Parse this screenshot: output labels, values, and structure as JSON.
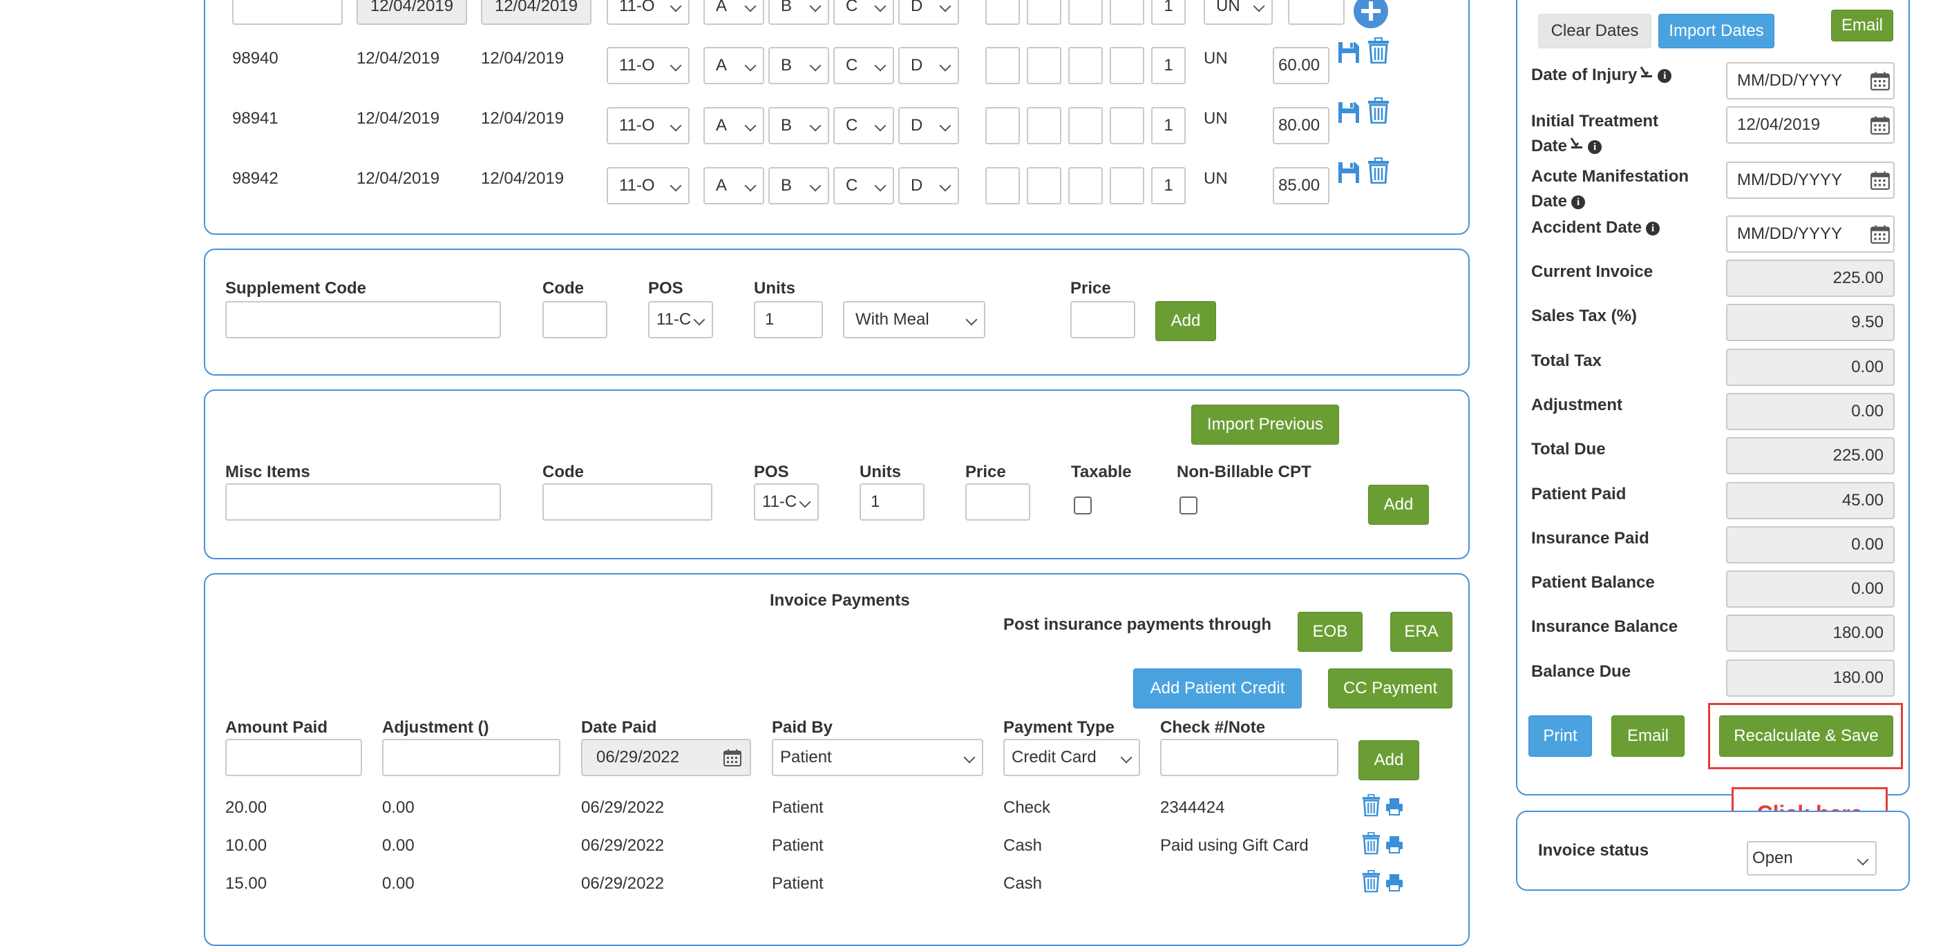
{
  "service_lines": {
    "top_row": {
      "date_from": "12/04/2019",
      "date_to": "12/04/2019",
      "pos": "11-O",
      "d1": "A",
      "d2": "B",
      "d3": "C",
      "d4": "D",
      "units": "1",
      "unit_type": "UN"
    },
    "rows": [
      {
        "code": "98940",
        "date_from": "12/04/2019",
        "date_to": "12/04/2019",
        "pos": "11-O",
        "d1": "A",
        "d2": "B",
        "d3": "C",
        "d4": "D",
        "units": "1",
        "unit_type": "UN",
        "price": "60.00"
      },
      {
        "code": "98941",
        "date_from": "12/04/2019",
        "date_to": "12/04/2019",
        "pos": "11-O",
        "d1": "A",
        "d2": "B",
        "d3": "C",
        "d4": "D",
        "units": "1",
        "unit_type": "UN",
        "price": "80.00"
      },
      {
        "code": "98942",
        "date_from": "12/04/2019",
        "date_to": "12/04/2019",
        "pos": "11-O",
        "d1": "A",
        "d2": "B",
        "d3": "C",
        "d4": "D",
        "units": "1",
        "unit_type": "UN",
        "price": "85.00"
      }
    ]
  },
  "supplement": {
    "code_label": "Supplement Code",
    "code2_label": "Code",
    "pos_label": "POS",
    "units_label": "Units",
    "price_label": "Price",
    "pos_value": "11-C",
    "units_value": "1",
    "meal_value": "With Meal",
    "add_label": "Add"
  },
  "misc": {
    "items_label": "Misc Items",
    "code_label": "Code",
    "pos_label": "POS",
    "units_label": "Units",
    "price_label": "Price",
    "taxable_label": "Taxable",
    "nonbillable_label": "Non-Billable CPT",
    "pos_value": "11-C",
    "units_value": "1",
    "import_previous_label": "Import Previous",
    "add_label": "Add"
  },
  "payments": {
    "title": "Invoice Payments",
    "post_through_label": "Post insurance payments through",
    "eob_label": "EOB",
    "era_label": "ERA",
    "add_patient_credit_label": "Add Patient Credit",
    "cc_payment_label": "CC Payment",
    "headers": {
      "amount": "Amount Paid",
      "adjustment": "Adjustment ()",
      "date": "Date Paid",
      "paid_by": "Paid By",
      "type": "Payment Type",
      "check": "Check #/Note"
    },
    "new": {
      "date": "06/29/2022",
      "paid_by": "Patient",
      "type": "Credit Card"
    },
    "add_label": "Add",
    "rows": [
      {
        "amount": "20.00",
        "adjustment": "0.00",
        "date": "06/29/2022",
        "paid_by": "Patient",
        "type": "Check",
        "note": "2344424"
      },
      {
        "amount": "10.00",
        "adjustment": "0.00",
        "date": "06/29/2022",
        "paid_by": "Patient",
        "type": "Cash",
        "note": "Paid using Gift Card"
      },
      {
        "amount": "15.00",
        "adjustment": "0.00",
        "date": "06/29/2022",
        "paid_by": "Patient",
        "type": "Cash",
        "note": ""
      }
    ]
  },
  "summary": {
    "clear_dates_label": "Clear Dates",
    "import_dates_label": "Import Dates",
    "email_top_label": "Email",
    "date_of_injury_label": "Date of Injury",
    "date_of_injury_value": "MM/DD/YYYY",
    "initial_treatment_label_1": "Initial Treatment",
    "initial_treatment_label_2": "Date",
    "initial_treatment_value": "12/04/2019",
    "acute_label_1": "Acute Manifestation",
    "acute_label_2": "Date",
    "acute_value": "MM/DD/YYYY",
    "accident_label": "Accident Date",
    "accident_value": "MM/DD/YYYY",
    "fields": [
      {
        "label": "Current Invoice",
        "value": "225.00"
      },
      {
        "label": "Sales Tax (%)",
        "value": "9.50"
      },
      {
        "label": "Total Tax",
        "value": "0.00"
      },
      {
        "label": "Adjustment",
        "value": "0.00"
      },
      {
        "label": "Total Due",
        "value": "225.00"
      },
      {
        "label": "Patient Paid",
        "value": "45.00"
      },
      {
        "label": "Insurance Paid",
        "value": "0.00"
      },
      {
        "label": "Patient Balance",
        "value": "0.00"
      },
      {
        "label": "Insurance Balance",
        "value": "180.00"
      },
      {
        "label": "Balance Due",
        "value": "180.00"
      }
    ],
    "print_label": "Print",
    "email_label": "Email",
    "recalc_label": "Recalculate & Save",
    "callout": "Click here",
    "status_label": "Invoice status",
    "status_value": "Open"
  },
  "colors": {
    "panel_border": "#4a90d9",
    "green": "#6a9e34",
    "blue": "#4aa3df",
    "highlight": "#e0403a"
  }
}
